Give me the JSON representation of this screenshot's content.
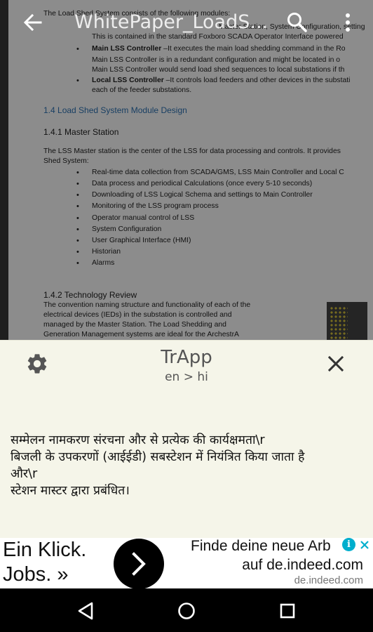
{
  "appbar": {
    "title": "WhitePaper_LoadS..."
  },
  "document": {
    "intro_line": "The Load Shed System consists of the following modules:",
    "intro_frag_1": "Master Station, System Configuration, setting",
    "intro_frag_2": "This is contained in the standard Foxboro SCADA Operator Interface powered",
    "main_lss_label": "Main LSS Controller",
    "main_lss_text": " –It executes the main load shedding command in the Ro",
    "main_lss_line2": "Main LSS Controller is in a redundant configuration and might be located in o",
    "main_lss_line3": "Main LSS Controller would send load shed sequences to local substations if th",
    "local_lss_label": "Local LSS Controller",
    "local_lss_text": " –It controls load feeders and other devices in the substati",
    "local_lss_line2": "each of the feeder substations.",
    "section_heading": "1.4 Load Shed System Module Design",
    "sub_heading_1": "1.4.1 Master Station",
    "master_para_1": "The LSS Master station is the center of the LSS for data processing and controls. It provides",
    "master_para_2": "Shed System:",
    "bullets": [
      "Real-time data collection from SCADA/GMS, LSS Main Controller and Local C",
      "Data process and periodical Calculations (once every 5-10 seconds)",
      "Downloading of LSS Logical Schema and settings to Main Controller",
      "Monitoring of the LSS program process",
      "Operator manual control of LSS",
      "System Configuration",
      "User Graphical Interface (HMI)",
      "Historian",
      "Alarms"
    ],
    "sub_heading_2": "1.4.2 Technology Review",
    "tech_lines": [
      "The convention naming structure and functionality of each of the",
      "electrical devices (IEDs) in the substation is controlled and",
      "managed by the Master Station.  The Load Shedding and",
      "Generation Management systems are ideal for the ArchestrA"
    ]
  },
  "popup": {
    "app_title": "TrApp",
    "language_pair": "en > hi",
    "translation_lines": [
      "सम्मेलन नामकरण संरचना और से प्रत्येक की कार्यक्षमता\\r",
      "बिजली के उपकरणों (आईईडी) सबस्टेशन में नियंत्रित किया जाता है",
      "और\\r",
      "स्टेशन मास्टर द्वारा प्रबंधित।"
    ]
  },
  "ad": {
    "headline_1": "Ein Klick.",
    "headline_2": "Jobs. »",
    "line1": "Finde deine neue Arb",
    "line2": "auf de.indeed.com",
    "domain": "de.indeed.com",
    "info_glyph": "i"
  },
  "colors": {
    "popup_bg": "#f5f5e9",
    "heading_blue": "#2e74b5",
    "ad_info": "#00aecd"
  }
}
